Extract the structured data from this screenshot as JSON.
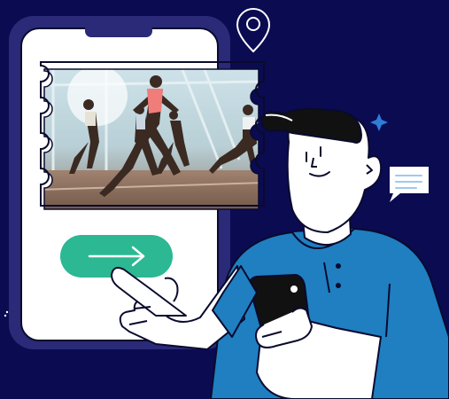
{
  "colors": {
    "background": "#0b0b52",
    "phone_frame": "#2a2a78",
    "phone_screen": "#ffffff",
    "outline": "#0a0a2e",
    "button_green": "#2bb893",
    "shirt_blue": "#1f7fc1",
    "hair": "#111111",
    "sparkle": "#2e7dd6",
    "bubble_lines": "#9ec9f0"
  },
  "icons": {
    "location": "location-pin-icon",
    "next": "arrow-right-icon",
    "chat": "chat-bubble-icon",
    "sparkle": "sparkle-icon"
  }
}
